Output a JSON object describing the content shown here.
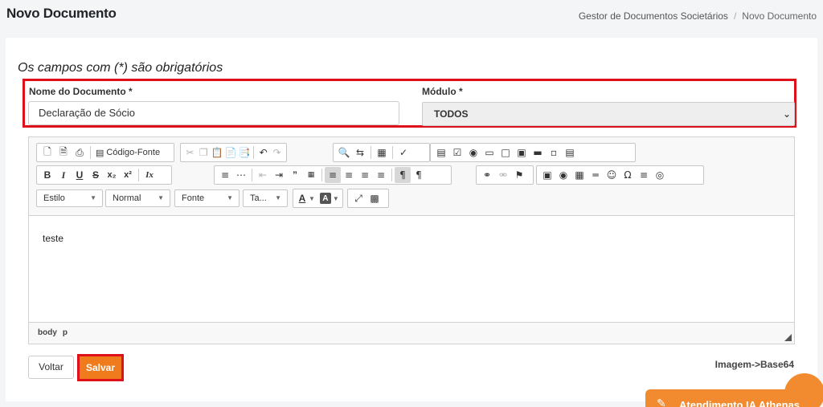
{
  "header": {
    "title": "Novo Documento",
    "breadcrumb": {
      "parent": "Gestor de Documentos Societários",
      "separator": "/",
      "current": "Novo Documento"
    }
  },
  "form": {
    "required_note": "Os campos com (*) são obrigatórios",
    "nome": {
      "label": "Nome do Documento *",
      "value": "Declaração de Sócio"
    },
    "modulo": {
      "label": "Módulo *",
      "selected": "TODOS"
    }
  },
  "editor": {
    "toolbar": {
      "source_label": "Código-Fonte",
      "combo_estilo": "Estilo",
      "combo_formato": "Normal",
      "combo_fonte": "Fonte",
      "combo_tamanho": "Ta...",
      "bold": "B",
      "italic": "I",
      "underline": "U",
      "strike": "S",
      "sub": "x₂",
      "sup": "x²",
      "remove_format": "Ix",
      "text_color": "A",
      "bg_color": "A"
    },
    "content": "teste",
    "path": [
      "body",
      "p"
    ]
  },
  "actions": {
    "voltar": "Voltar",
    "salvar": "Salvar",
    "base64_link": "Imagem->Base64"
  },
  "chat": {
    "label": "Atendimento IA Athenas"
  },
  "colors": {
    "accent": "#f07b1d",
    "highlight_border": "#e0101a"
  }
}
